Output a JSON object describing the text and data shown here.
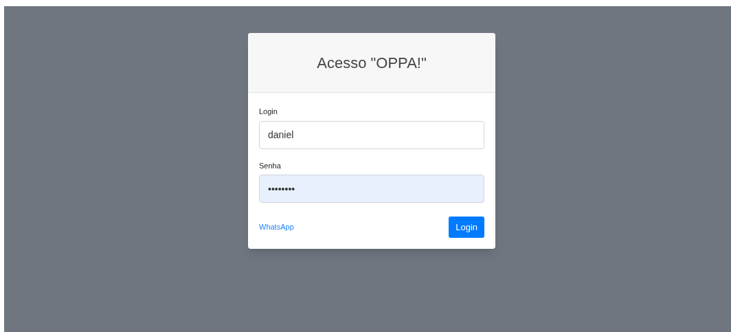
{
  "dialog": {
    "title": "Acesso \"OPPA!\"",
    "fields": [
      {
        "label": "Login",
        "value": "daniel",
        "autofilled": false
      },
      {
        "label": "Senha",
        "value": "••••••••",
        "autofilled": true
      }
    ],
    "link": "WhatsApp",
    "button": "Login"
  }
}
